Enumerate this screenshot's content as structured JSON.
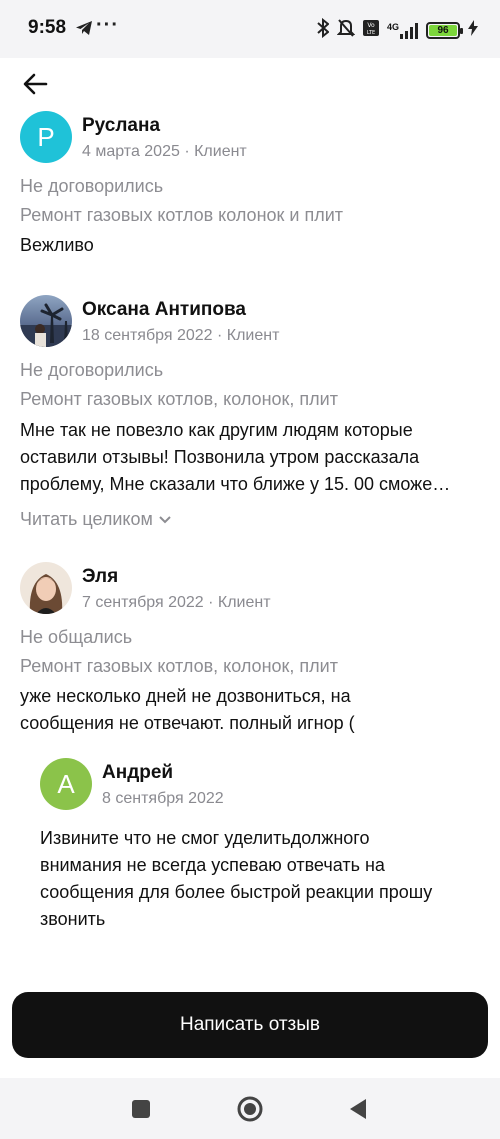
{
  "status_bar": {
    "time": "9:58",
    "dots": "···",
    "battery": "96",
    "network": "4G"
  },
  "reviews": [
    {
      "avatar_letter": "Р",
      "avatar_color": "#1fc2d8",
      "name": "Руслана",
      "meta": "4 марта 2025 · Клиент",
      "status": "Не договорились",
      "service": "Ремонт газовых котлов колонок и плит",
      "text": "Вежливо"
    },
    {
      "name": "Оксана Антипова",
      "meta": "18 сентября 2022 · Клиент",
      "status": "Не договорились",
      "service": "Ремонт газовых котлов, колонок, плит",
      "text_lines": [
        "Мне так не повезло как другим людям которые",
        "оставили отзывы! Позвонила утром рассказала",
        "проблему, Мне сказали что ближе у 15. 00 сможе…"
      ],
      "read_more": "Читать целиком"
    },
    {
      "name": "Эля",
      "meta": "7 сентября 2022 · Клиент",
      "status": "Не общались",
      "service": "Ремонт газовых котлов, колонок, плит",
      "text_lines": [
        "уже несколько дней не дозвониться, на",
        "сообщения не отвечают. полный игнор ("
      ],
      "reply": {
        "avatar_letter": "А",
        "avatar_color": "#8bc34a",
        "name": "Андрей",
        "date": "8 сентября 2022",
        "text_lines": [
          "Извините что не смог уделитьдолжного",
          "внимания не всегда успеваю отвечать на",
          "сообщения для более быстрой реакции прошу",
          "звонить"
        ]
      }
    }
  ],
  "cta_label": "Написать отзыв"
}
